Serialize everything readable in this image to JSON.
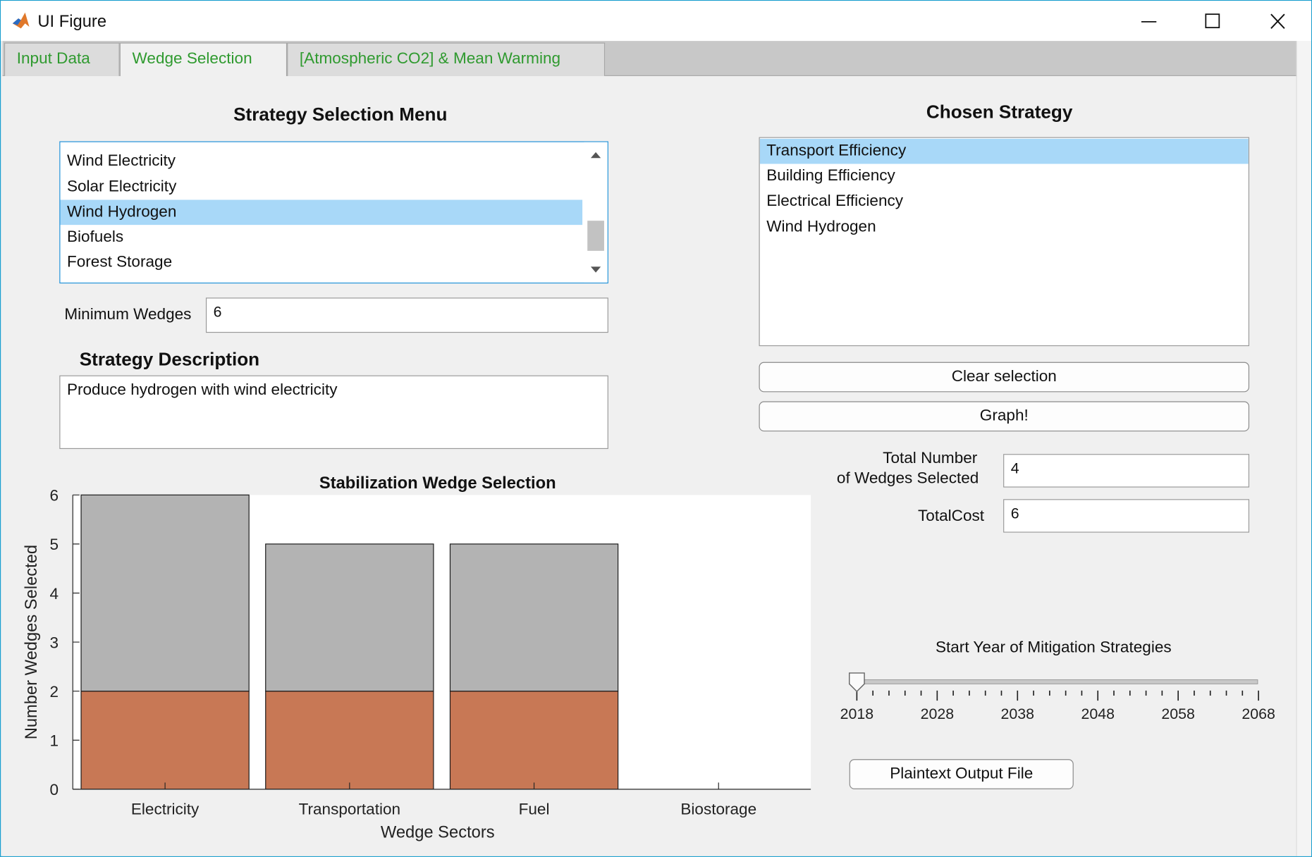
{
  "window": {
    "title": "UI Figure",
    "controls": {
      "minimize": "—",
      "maximize": "☐",
      "close": "✕"
    }
  },
  "tabs": [
    {
      "label": "Input Data",
      "active": false
    },
    {
      "label": "Wedge Selection",
      "active": true
    },
    {
      "label": "[Atmospheric CO2] & Mean Warming",
      "active": false
    }
  ],
  "strategy_menu": {
    "heading": "Strategy Selection Menu",
    "items": [
      "Wind Electricity",
      "Solar Electricity",
      "Wind Hydrogen",
      "Biofuels",
      "Forest Storage"
    ],
    "selected_index": 2
  },
  "minimum_wedges": {
    "label": "Minimum Wedges",
    "value": "6"
  },
  "description": {
    "heading": "Strategy Description",
    "text": "Produce hydrogen with wind electricity"
  },
  "chosen": {
    "heading": "Chosen Strategy",
    "items": [
      "Transport Efficiency",
      "Building Efficiency",
      "Electrical Efficiency",
      "Wind Hydrogen"
    ],
    "selected_index": 0
  },
  "buttons": {
    "clear": "Clear selection",
    "graph": "Graph!",
    "plaintext": "Plaintext Output File"
  },
  "totals": {
    "wedges_label_1": "Total Number",
    "wedges_label_2": "of Wedges Selected",
    "wedges_value": "4",
    "cost_label": "TotalCost",
    "cost_value": "6"
  },
  "slider": {
    "label": "Start Year of Mitigation Strategies",
    "min": 2018,
    "max": 2068,
    "value": 2018,
    "tick_labels": [
      "2018",
      "2028",
      "2038",
      "2048",
      "2058",
      "2068"
    ]
  },
  "chart_data": {
    "type": "bar",
    "title": "Stabilization Wedge Selection",
    "xlabel": "Wedge Sectors",
    "ylabel": "Number Wedges Selected",
    "categories": [
      "Electricity",
      "Transportation",
      "Fuel",
      "Biostorage"
    ],
    "stacked": true,
    "series": [
      {
        "values": [
          2,
          2,
          2,
          0
        ],
        "color": "#c87855"
      },
      {
        "values": [
          4,
          3,
          3,
          0
        ],
        "color": "#b3b3b3"
      }
    ],
    "ylim": [
      0,
      6
    ],
    "yticks": [
      "0",
      "1",
      "2",
      "3",
      "4",
      "5",
      "6"
    ],
    "grid": false
  },
  "colors": {
    "tab_text": "#2f9a2f",
    "selection": "#a8d8f8",
    "focus_border": "#1e90d8"
  }
}
